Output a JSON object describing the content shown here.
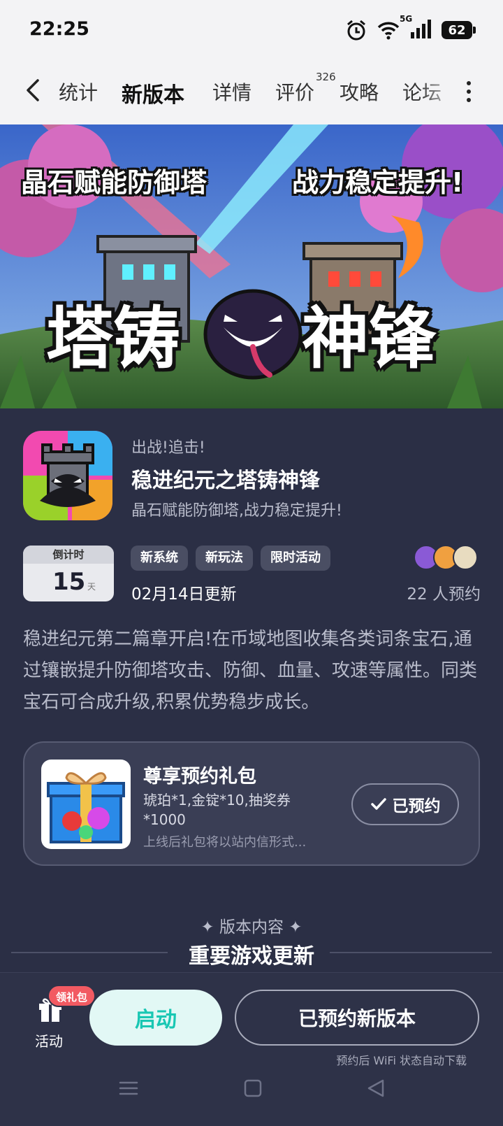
{
  "status_bar": {
    "time": "22:25",
    "network": "5G",
    "battery": "62"
  },
  "nav": {
    "tabs": [
      {
        "label": "统计"
      },
      {
        "label": "新版本",
        "active": true
      },
      {
        "label": "详情"
      },
      {
        "label": "评价",
        "badge": "326"
      },
      {
        "label": "攻略"
      },
      {
        "label": "论坛"
      }
    ]
  },
  "banner": {
    "left_text": "晶石赋能防御塔",
    "right_text": "战力稳定提升!",
    "title_left": "塔铸",
    "title_right": "神锋"
  },
  "game": {
    "tagline": "出战!追击!",
    "title": "稳进纪元之塔铸神锋",
    "subtitle": "晶石赋能防御塔,战力稳定提升!"
  },
  "countdown": {
    "label": "倒计时",
    "value": "15",
    "unit": "天"
  },
  "tags": [
    "新系统",
    "新玩法",
    "限时活动"
  ],
  "update_date": "02月14日更新",
  "reserve_count": "22 人预约",
  "description": "稳进纪元第二篇章开启!在币域地图收集各类词条宝石,通过镶嵌提升防御塔攻击、防御、血量、攻速等属性。同类宝石可合成升级,积累优势稳步成长。",
  "gift": {
    "title": "尊享预约礼包",
    "items": "琥珀*1,金锭*10,抽奖券*1000",
    "note": "上线后礼包将以站内信形式...",
    "button": "已预约"
  },
  "section": {
    "subtitle": "✦ 版本内容 ✦",
    "title": "重要游戏更新"
  },
  "bottom": {
    "activity_label": "活动",
    "badge": "领礼包",
    "start_button": "启动",
    "reserved_button": "已预约新版本",
    "wifi_note": "预约后 WiFi 状态自动下载"
  },
  "colors": {
    "accent": "#19d4c0",
    "background": "#2b2f45",
    "badge": "#f25a62"
  }
}
